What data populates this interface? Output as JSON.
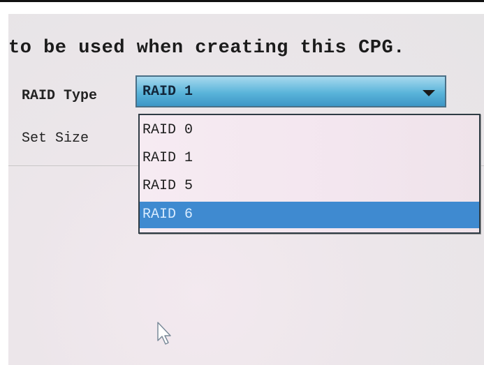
{
  "instruction_text": "to be used when creating this CPG.",
  "form": {
    "raid_type_label": "RAID Type",
    "set_size_label": "Set Size"
  },
  "raid_select": {
    "selected_value": "RAID 1",
    "arrow_icon": "chevron-down-icon",
    "highlight_color": "#3f8ad0",
    "options": [
      {
        "label": "RAID 0",
        "highlighted": false
      },
      {
        "label": "RAID 1",
        "highlighted": false
      },
      {
        "label": "RAID 5",
        "highlighted": false
      },
      {
        "label": "RAID 6",
        "highlighted": true
      }
    ]
  },
  "pointer_icon": "mouse-pointer-icon"
}
